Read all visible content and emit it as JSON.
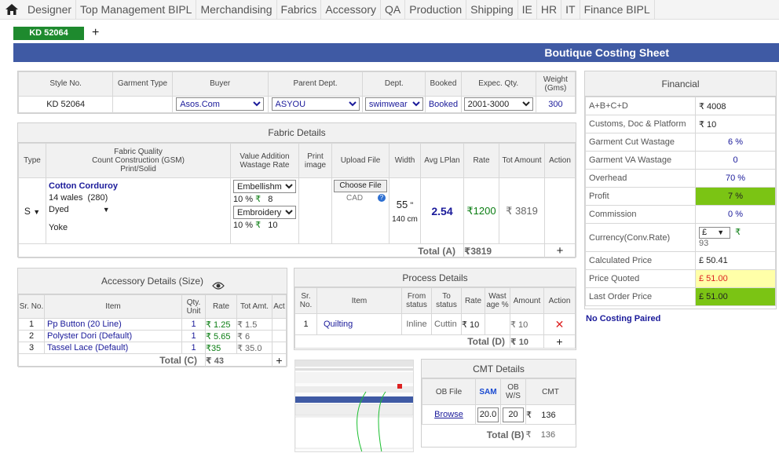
{
  "nav": {
    "items": [
      "Designer",
      "Top Management BIPL",
      "Merchandising",
      "Fabrics",
      "Accessory",
      "QA",
      "Production",
      "Shipping",
      "IE",
      "HR",
      "IT",
      "Finance BIPL"
    ]
  },
  "tabs": {
    "active": "KD 52064",
    "add": "+"
  },
  "title": "Boutique Costing Sheet",
  "style": {
    "headers": [
      "Style No.",
      "Garment Type",
      "Buyer",
      "Parent Dept.",
      "Dept.",
      "Booked",
      "Expec. Qty.",
      "Weight (Gms)"
    ],
    "style_no": "KD 52064",
    "garment_type": "",
    "buyer": "Asos.Com",
    "parent_dept": "ASYOU",
    "dept": "swimwear",
    "booked": "Booked",
    "expec_qty": "2001-3000",
    "weight": "300"
  },
  "fabric": {
    "title": "Fabric Details",
    "headers": {
      "type": "Type",
      "quality": "Fabric Quality\nCount Construction (GSM)\nPrint/Solid",
      "value_addition": "Value Addition\nWastage Rate",
      "print_image": "Print image",
      "upload": "Upload File",
      "width": "Width",
      "avg": "Avg LPlan",
      "rate": "Rate",
      "tot": "Tot Amount",
      "action": "Action"
    },
    "type": "S",
    "quality": "Cotton Corduroy",
    "construction": "14 wales",
    "gsm": "(280)",
    "print_solid": "Dyed",
    "placement": "Yoke",
    "va1": "Embellishm",
    "va1_pct": "10 %",
    "va1_rate": "8",
    "va2": "Embroidery",
    "va2_pct": "10 %",
    "va2_rate": "10",
    "choose_file": "Choose File",
    "cad": "CAD",
    "width_val": "55",
    "width_unit": "\"",
    "width_cm": "140 cm",
    "avg": "2.54",
    "rate": "₹1200",
    "tot": "₹ 3819",
    "total_label": "Total (A)",
    "total": "₹3819",
    "currency": "₹"
  },
  "accessory": {
    "title": "Accessory Details (Size)",
    "headers": [
      "Sr. No.",
      "Item",
      "Qty. Unit",
      "Rate",
      "Tot Amt.",
      "Act"
    ],
    "rows": [
      {
        "sr": "1",
        "item": "Pp Button (20 Line)",
        "qty": "1",
        "rate": "₹ 1.25",
        "tot": "₹ 1.5"
      },
      {
        "sr": "2",
        "item": "Polyster Dori (Default)",
        "qty": "1",
        "rate": "₹ 5.65",
        "tot": "₹ 6"
      },
      {
        "sr": "3",
        "item": "Tassel Lace (Default)",
        "qty": "1",
        "rate": "₹35",
        "tot": "₹ 35.0"
      }
    ],
    "total_label": "Total (C)",
    "total": "₹ 43"
  },
  "process": {
    "title": "Process Details",
    "headers": [
      "Sr. No.",
      "Item",
      "From status",
      "To status",
      "Rate",
      "Wast age %",
      "Amount",
      "Action"
    ],
    "row": {
      "sr": "1",
      "item": "Quilting",
      "from": "Inline",
      "to": "Cuttin",
      "rate": "₹ 10",
      "wastage": "",
      "amount": "₹ 10"
    },
    "total_label": "Total (D)",
    "total": "₹ 10"
  },
  "cmt": {
    "title": "CMT Details",
    "headers": [
      "OB File",
      "SAM",
      "OB W/S",
      "CMT"
    ],
    "browse": "Browse",
    "sam": "20.0",
    "ob_ws": "20",
    "cmt": "136",
    "total_label": "Total (B)",
    "total": "136",
    "currency": "₹"
  },
  "financial": {
    "title": "Financial",
    "rows": [
      {
        "label": "A+B+C+D",
        "value": "₹ 4008"
      },
      {
        "label": "Customs, Doc & Platform",
        "value": "₹ 10"
      },
      {
        "label": "Garment Cut Wastage",
        "value": "6 %"
      },
      {
        "label": "Garment VA Wastage",
        "value": "0"
      },
      {
        "label": "Overhead",
        "value": "70 %"
      },
      {
        "label": "Profit",
        "value": "7 %"
      },
      {
        "label": "Commission",
        "value": "0 %"
      },
      {
        "label": "Currency(Conv.Rate)",
        "value": "£",
        "extra": "93",
        "symbol": "₹"
      },
      {
        "label": "Calculated Price",
        "value": "£ 50.41"
      },
      {
        "label": "Price Quoted",
        "value": "£ 51.00"
      },
      {
        "label": "Last Order Price",
        "value": "£ 51.00"
      }
    ],
    "no_costing": "No Costing Paired"
  },
  "colors": {
    "accent": "#3f5aa4",
    "tab": "#1e8a2e",
    "profit": "#7bc414",
    "quoted": "#ffffa8"
  }
}
